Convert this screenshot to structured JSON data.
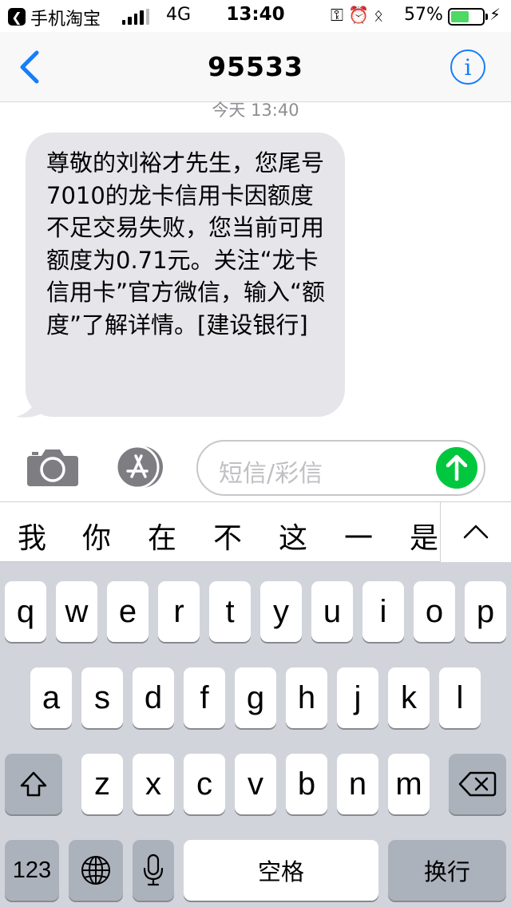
{
  "status_bar": {
    "back_app": "手机淘宝",
    "network": "4G",
    "time": "13:40",
    "battery": "57%",
    "battery_level": 0.57
  },
  "nav": {
    "title": "95533",
    "back_icon": "chevron-left-icon",
    "info_icon": "info-icon"
  },
  "conversation": {
    "timestamp": "今天 13:40",
    "message": "尊敬的刘裕才先生，您尾号7010的龙卡信用卡因额度不足交易失败，您当前可用额度为0.71元。关注“龙卡信用卡”官方微信，输入“额度”了解详情。[建设银行]"
  },
  "composer": {
    "placeholder": "短信/彩信",
    "camera_icon": "camera-icon",
    "appstore_icon": "app-store-icon",
    "send_icon": "send-arrow-icon"
  },
  "candidates": [
    "我",
    "你",
    "在",
    "不",
    "这",
    "一",
    "是"
  ],
  "keyboard": {
    "row1": [
      "q",
      "w",
      "e",
      "r",
      "t",
      "y",
      "u",
      "i",
      "o",
      "p"
    ],
    "row2": [
      "a",
      "s",
      "d",
      "f",
      "g",
      "h",
      "j",
      "k",
      "l"
    ],
    "row3": [
      "z",
      "x",
      "c",
      "v",
      "b",
      "n",
      "m"
    ],
    "numbers_label": "123",
    "space_label": "空格",
    "return_label": "换行",
    "shift_icon": "shift-icon",
    "delete_icon": "delete-icon",
    "globe_icon": "globe-icon",
    "mic_icon": "microphone-icon"
  },
  "colors": {
    "accent_blue": "#147efb",
    "send_green": "#00c73d",
    "bubble_gray": "#e5e5ea",
    "keyboard_bg": "#d1d4db"
  }
}
